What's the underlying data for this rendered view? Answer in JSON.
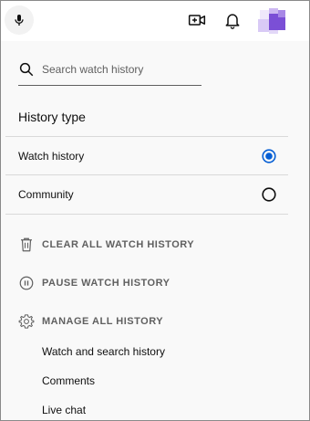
{
  "header": {
    "mic_icon": "microphone-icon",
    "create_icon": "video-create-icon",
    "notifications_icon": "bell-icon",
    "avatar_icon": "avatar-image",
    "avatar_color": "#7b4fd6"
  },
  "panel": {
    "search": {
      "placeholder": "Search watch history",
      "value": ""
    },
    "history_type": {
      "title": "History type",
      "options": [
        {
          "label": "Watch history",
          "selected": true
        },
        {
          "label": "Community",
          "selected": false
        }
      ]
    },
    "actions": {
      "clear": {
        "label": "CLEAR ALL WATCH HISTORY",
        "icon": "trash-icon"
      },
      "pause": {
        "label": "PAUSE WATCH HISTORY",
        "icon": "pause-circle-icon"
      },
      "manage": {
        "label": "MANAGE ALL HISTORY",
        "icon": "gear-icon"
      }
    },
    "manage_links": [
      {
        "label": "Watch and search history"
      },
      {
        "label": "Comments"
      },
      {
        "label": "Live chat"
      }
    ]
  },
  "colors": {
    "accent": "#065fd4",
    "secondary_text": "#606060",
    "divider": "#d9d9d9"
  }
}
